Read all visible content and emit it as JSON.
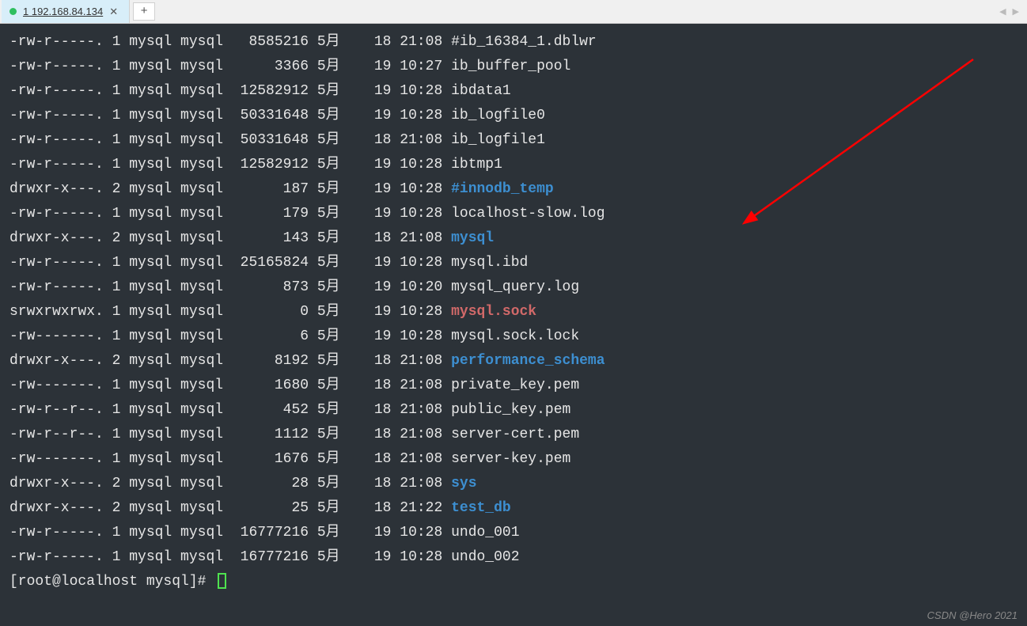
{
  "tab": {
    "label": "1 192.168.84.134"
  },
  "listing": [
    {
      "perms": "-rw-r-----.",
      "links": "1",
      "user": "mysql",
      "group": "mysql",
      "size": "8585216",
      "month": "5月",
      "day": "18",
      "time": "21:08",
      "name": "#ib_16384_1.dblwr",
      "type": "file"
    },
    {
      "perms": "-rw-r-----.",
      "links": "1",
      "user": "mysql",
      "group": "mysql",
      "size": "3366",
      "month": "5月",
      "day": "19",
      "time": "10:27",
      "name": "ib_buffer_pool",
      "type": "file"
    },
    {
      "perms": "-rw-r-----.",
      "links": "1",
      "user": "mysql",
      "group": "mysql",
      "size": "12582912",
      "month": "5月",
      "day": "19",
      "time": "10:28",
      "name": "ibdata1",
      "type": "file"
    },
    {
      "perms": "-rw-r-----.",
      "links": "1",
      "user": "mysql",
      "group": "mysql",
      "size": "50331648",
      "month": "5月",
      "day": "19",
      "time": "10:28",
      "name": "ib_logfile0",
      "type": "file"
    },
    {
      "perms": "-rw-r-----.",
      "links": "1",
      "user": "mysql",
      "group": "mysql",
      "size": "50331648",
      "month": "5月",
      "day": "18",
      "time": "21:08",
      "name": "ib_logfile1",
      "type": "file"
    },
    {
      "perms": "-rw-r-----.",
      "links": "1",
      "user": "mysql",
      "group": "mysql",
      "size": "12582912",
      "month": "5月",
      "day": "19",
      "time": "10:28",
      "name": "ibtmp1",
      "type": "file"
    },
    {
      "perms": "drwxr-x---.",
      "links": "2",
      "user": "mysql",
      "group": "mysql",
      "size": "187",
      "month": "5月",
      "day": "19",
      "time": "10:28",
      "name": "#innodb_temp",
      "type": "dir"
    },
    {
      "perms": "-rw-r-----.",
      "links": "1",
      "user": "mysql",
      "group": "mysql",
      "size": "179",
      "month": "5月",
      "day": "19",
      "time": "10:28",
      "name": "localhost-slow.log",
      "type": "file"
    },
    {
      "perms": "drwxr-x---.",
      "links": "2",
      "user": "mysql",
      "group": "mysql",
      "size": "143",
      "month": "5月",
      "day": "18",
      "time": "21:08",
      "name": "mysql",
      "type": "dir"
    },
    {
      "perms": "-rw-r-----.",
      "links": "1",
      "user": "mysql",
      "group": "mysql",
      "size": "25165824",
      "month": "5月",
      "day": "19",
      "time": "10:28",
      "name": "mysql.ibd",
      "type": "file"
    },
    {
      "perms": "-rw-r-----.",
      "links": "1",
      "user": "mysql",
      "group": "mysql",
      "size": "873",
      "month": "5月",
      "day": "19",
      "time": "10:20",
      "name": "mysql_query.log",
      "type": "file"
    },
    {
      "perms": "srwxrwxrwx.",
      "links": "1",
      "user": "mysql",
      "group": "mysql",
      "size": "0",
      "month": "5月",
      "day": "19",
      "time": "10:28",
      "name": "mysql.sock",
      "type": "sock"
    },
    {
      "perms": "-rw-------.",
      "links": "1",
      "user": "mysql",
      "group": "mysql",
      "size": "6",
      "month": "5月",
      "day": "19",
      "time": "10:28",
      "name": "mysql.sock.lock",
      "type": "file"
    },
    {
      "perms": "drwxr-x---.",
      "links": "2",
      "user": "mysql",
      "group": "mysql",
      "size": "8192",
      "month": "5月",
      "day": "18",
      "time": "21:08",
      "name": "performance_schema",
      "type": "dir"
    },
    {
      "perms": "-rw-------.",
      "links": "1",
      "user": "mysql",
      "group": "mysql",
      "size": "1680",
      "month": "5月",
      "day": "18",
      "time": "21:08",
      "name": "private_key.pem",
      "type": "file"
    },
    {
      "perms": "-rw-r--r--.",
      "links": "1",
      "user": "mysql",
      "group": "mysql",
      "size": "452",
      "month": "5月",
      "day": "18",
      "time": "21:08",
      "name": "public_key.pem",
      "type": "file"
    },
    {
      "perms": "-rw-r--r--.",
      "links": "1",
      "user": "mysql",
      "group": "mysql",
      "size": "1112",
      "month": "5月",
      "day": "18",
      "time": "21:08",
      "name": "server-cert.pem",
      "type": "file"
    },
    {
      "perms": "-rw-------.",
      "links": "1",
      "user": "mysql",
      "group": "mysql",
      "size": "1676",
      "month": "5月",
      "day": "18",
      "time": "21:08",
      "name": "server-key.pem",
      "type": "file"
    },
    {
      "perms": "drwxr-x---.",
      "links": "2",
      "user": "mysql",
      "group": "mysql",
      "size": "28",
      "month": "5月",
      "day": "18",
      "time": "21:08",
      "name": "sys",
      "type": "dir"
    },
    {
      "perms": "drwxr-x---.",
      "links": "2",
      "user": "mysql",
      "group": "mysql",
      "size": "25",
      "month": "5月",
      "day": "18",
      "time": "21:22",
      "name": "test_db",
      "type": "dir"
    },
    {
      "perms": "-rw-r-----.",
      "links": "1",
      "user": "mysql",
      "group": "mysql",
      "size": "16777216",
      "month": "5月",
      "day": "19",
      "time": "10:28",
      "name": "undo_001",
      "type": "file"
    },
    {
      "perms": "-rw-r-----.",
      "links": "1",
      "user": "mysql",
      "group": "mysql",
      "size": "16777216",
      "month": "5月",
      "day": "19",
      "time": "10:28",
      "name": "undo_002",
      "type": "file"
    }
  ],
  "prompt": "[root@localhost mysql]# ",
  "watermark": "CSDN @Hero 2021"
}
